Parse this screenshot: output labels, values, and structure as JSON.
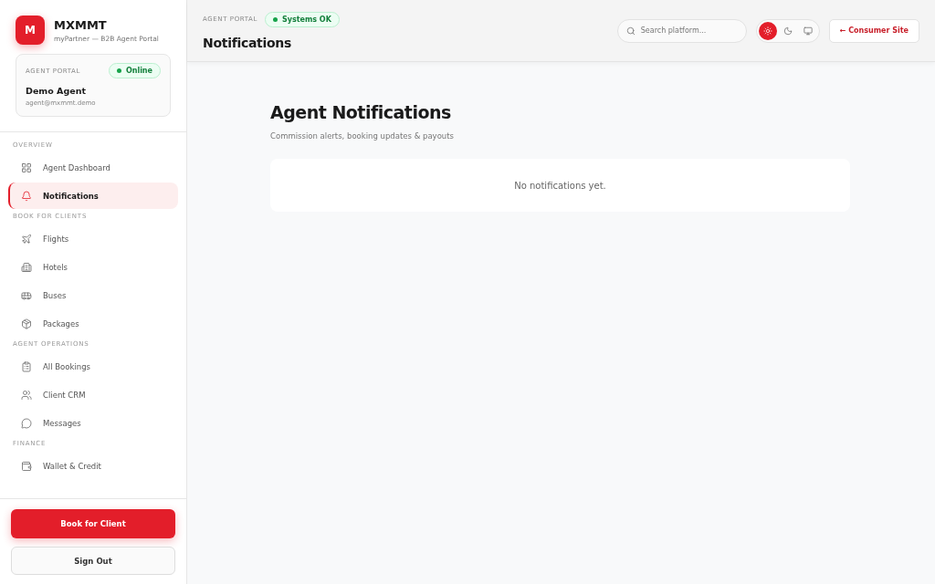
{
  "brand": {
    "logo": "M",
    "name": "MXMMT",
    "subtitle": "myPartner — B2B Agent Portal"
  },
  "agent_card": {
    "label": "AGENT PORTAL",
    "status": "Online",
    "name": "Demo Agent",
    "email": "agent@mxmmt.demo"
  },
  "sidebar": {
    "sections": [
      {
        "title": "OVERVIEW",
        "items": [
          {
            "label": "Agent Dashboard",
            "kind": "grid",
            "selected": false
          },
          {
            "label": "Notifications",
            "kind": "bell",
            "selected": true
          }
        ]
      },
      {
        "title": "BOOK FOR CLIENTS",
        "items": [
          {
            "label": "Flights",
            "kind": "plane",
            "selected": false
          },
          {
            "label": "Hotels",
            "kind": "building",
            "selected": false
          },
          {
            "label": "Buses",
            "kind": "bus",
            "selected": false
          },
          {
            "label": "Packages",
            "kind": "package",
            "selected": false
          }
        ]
      },
      {
        "title": "AGENT OPERATIONS",
        "items": [
          {
            "label": "All Bookings",
            "kind": "clipboard",
            "selected": false
          },
          {
            "label": "Client CRM",
            "kind": "users",
            "selected": false
          },
          {
            "label": "Messages",
            "kind": "message",
            "selected": false
          }
        ]
      },
      {
        "title": "FINANCE",
        "items": [
          {
            "label": "Wallet & Credit",
            "kind": "wallet",
            "selected": false
          }
        ]
      }
    ]
  },
  "primary_button": "Book for Client",
  "signout_button": "Sign Out",
  "header": {
    "eyebrow": "AGENT PORTAL",
    "status": "Systems OK",
    "title": "Notifications",
    "search": {
      "placeholder": "Search platform..."
    },
    "theme_options": [
      {
        "kind": "light",
        "selected": true
      },
      {
        "kind": "dark",
        "selected": false
      },
      {
        "kind": "system",
        "selected": false
      }
    ],
    "consumer_link": "← Consumer Site"
  },
  "page": {
    "title": "Agent Notifications",
    "subtitle": "Commission alerts, booking updates & payouts",
    "empty_message": "No notifications yet."
  }
}
